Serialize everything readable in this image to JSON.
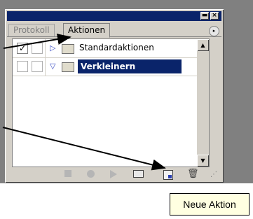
{
  "palette": {
    "titlebar": {
      "minimize_glyph": "▬",
      "close_glyph": "×"
    },
    "tabs": [
      {
        "label": "Protokoll",
        "active": false
      },
      {
        "label": "Aktionen",
        "active": true
      }
    ],
    "menu_glyph": "▸",
    "actions": [
      {
        "checked": true,
        "check_glyph": "✓",
        "expanded": false,
        "expander_glyph": "▷",
        "label": "Standardaktionen",
        "selected": false
      },
      {
        "checked": false,
        "check_glyph": "",
        "expanded": true,
        "expander_glyph": "▽",
        "label": "Verkleinern",
        "selected": true
      }
    ],
    "scrollbar": {
      "up_glyph": "▲",
      "down_glyph": "▼"
    },
    "bottom_toolbar": {
      "icons": [
        "stop-icon",
        "record-icon",
        "play-icon",
        "new-set-icon",
        "new-action-icon",
        "trash-icon"
      ],
      "trash_glyph": "🗑",
      "grip_glyph": "⋰"
    }
  },
  "tooltip": {
    "text": "Neue Aktion"
  },
  "colors": {
    "selection": "#0a246a",
    "panel": "#d4d0c8",
    "desktop": "#808080",
    "tooltip_bg": "#ffffe1"
  }
}
